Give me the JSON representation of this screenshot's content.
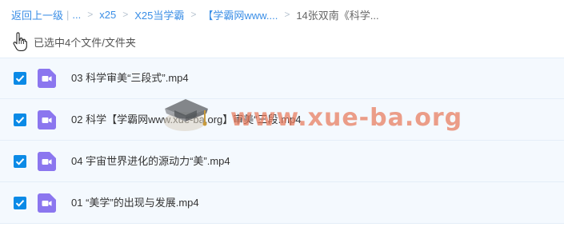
{
  "breadcrumb": {
    "back_label": "返回上一级",
    "bar": "|",
    "ellipsis": "...",
    "arrow": ">",
    "items": [
      "x25",
      "X25当学霸",
      "【学霸网www....",
      "14张双南《科学..."
    ]
  },
  "selection": {
    "status_text": "已选中4个文件/文件夹"
  },
  "files": [
    {
      "name": "03 科学审美“三段式”.mp4",
      "checked": true
    },
    {
      "name": "02 科学【学霸网www.xue-ba.org】审美“三段.mp4",
      "checked": true
    },
    {
      "name": "04 宇宙世界进化的源动力“美”.mp4",
      "checked": true
    },
    {
      "name": "01 “美学”的出现与发展.mp4",
      "checked": true
    }
  ],
  "watermark": {
    "text": "www.xue-ba.org"
  },
  "colors": {
    "link": "#3a8ee6",
    "checkbox": "#0b8ae6",
    "video_icon": "#8b76ef",
    "row_bg": "#f4f9fe",
    "watermark": "#e8785a"
  },
  "icons": {
    "cursor": "hand-pointer-icon",
    "file": "video-file-icon",
    "check": "checkmark-icon",
    "logo": "graduation-cap-icon"
  }
}
